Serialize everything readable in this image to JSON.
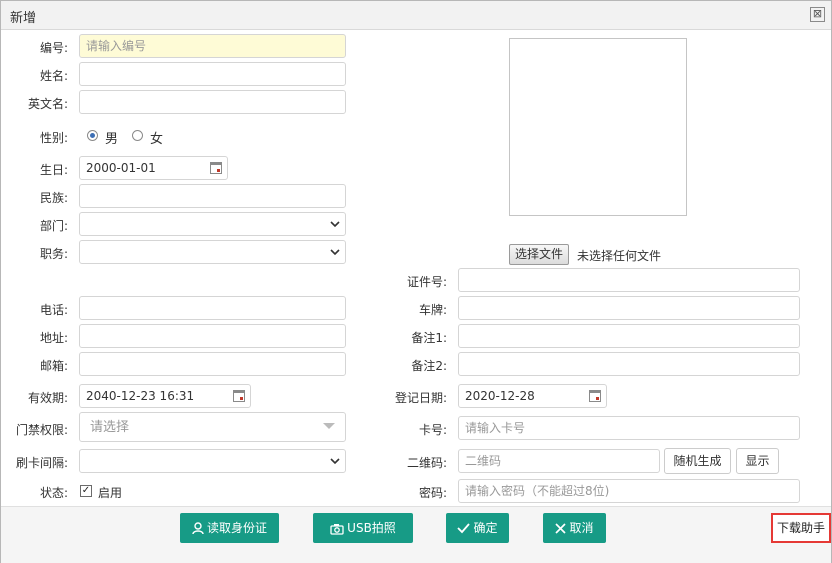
{
  "dialog": {
    "title": "新增",
    "close_glyph": "⊠"
  },
  "left": {
    "code": {
      "label": "编号:",
      "placeholder": "请输入编号"
    },
    "name": {
      "label": "姓名:"
    },
    "en_name": {
      "label": "英文名:"
    },
    "gender": {
      "label": "性别:",
      "options": [
        "男",
        "女"
      ],
      "selected": "男"
    },
    "birthday": {
      "label": "生日:",
      "value": "2000-01-01"
    },
    "ethnicity": {
      "label": "民族:"
    },
    "department": {
      "label": "部门:"
    },
    "position": {
      "label": "职务:"
    },
    "phone": {
      "label": "电话:"
    },
    "address": {
      "label": "地址:"
    },
    "email": {
      "label": "邮箱:"
    },
    "valid_until": {
      "label": "有效期:",
      "value": "2040-12-23 16:31"
    },
    "access": {
      "label": "门禁权限:",
      "placeholder": "请选择"
    },
    "card_interval": {
      "label": "刷卡间隔:"
    },
    "status": {
      "label": "状态:",
      "checkbox_label": "启用",
      "checked": true
    }
  },
  "right": {
    "file": {
      "button": "选择文件",
      "status": "未选择任何文件"
    },
    "id_number": {
      "label": "证件号:"
    },
    "plate": {
      "label": "车牌:"
    },
    "note1": {
      "label": "备注1:"
    },
    "note2": {
      "label": "备注2:"
    },
    "reg_date": {
      "label": "登记日期:",
      "value": "2020-12-28"
    },
    "card_no": {
      "label": "卡号:",
      "placeholder": "请输入卡号"
    },
    "qrcode": {
      "label": "二维码:",
      "placeholder": "二维码",
      "random_btn": "随机生成",
      "show_btn": "显示"
    },
    "password": {
      "label": "密码:",
      "placeholder": "请输入密码（不能超过8位)"
    }
  },
  "footer": {
    "read_id": "读取身份证",
    "usb_photo": "USB拍照",
    "confirm": "确定",
    "cancel": "取消",
    "download_helper": "下载助手",
    "accent_color": "#179b86",
    "highlight_color": "#e53935"
  }
}
